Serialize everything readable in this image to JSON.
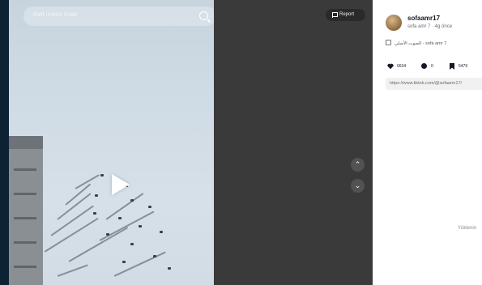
{
  "search": {
    "placeholder": "Rəfl iconlü kıtalı",
    "icon": "search-icon"
  },
  "video": {
    "state": "paused",
    "play_icon": "play-icon"
  },
  "report": {
    "label": "Report",
    "icon": "flag-icon"
  },
  "nav": {
    "up": "⌃",
    "down": "⌄"
  },
  "author": {
    "username": "sofaamr17",
    "subline": "sofa amr 7 · 4g önce",
    "description": "الصوت الأصلي - sofa amr 7"
  },
  "stats": {
    "likes": "6634",
    "comments": "0",
    "saves": "5479"
  },
  "link": {
    "url": "https://www.tiktok.com/@sofaamr17/"
  },
  "status": {
    "loading_text": "Yüklenin"
  },
  "colors": {
    "panel_bg": "#ffffff",
    "dark_bg": "#3a3a3a",
    "frame": "#0e2233"
  }
}
